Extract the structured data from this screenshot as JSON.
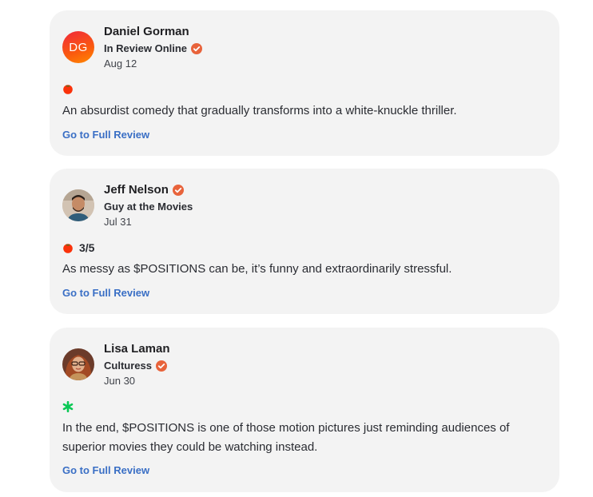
{
  "reviews": [
    {
      "initials": "DG",
      "critic": "Daniel Gorman",
      "publication": "In Review Online",
      "date": "Aug 12",
      "score": "",
      "quote": "An absurdist comedy that gradually transforms into a white-knuckle thriller.",
      "link": "Go to Full Review",
      "score_icon": "fresh-tomato-icon"
    },
    {
      "critic": "Jeff Nelson",
      "publication": "Guy at the Movies",
      "date": "Jul 31",
      "score": "3/5",
      "quote": "As messy as $POSITIONS can be, it’s funny and extraordinarily stressful.",
      "link": "Go to Full Review",
      "score_icon": "fresh-tomato-icon"
    },
    {
      "critic": "Lisa Laman",
      "publication": "Culturess",
      "date": "Jun 30",
      "score": "",
      "quote": "In the end, $POSITIONS is one of those motion pictures just reminding audiences of superior movies they could be watching instead.",
      "link": "Go to Full Review",
      "score_icon": "rotten-splat-icon"
    }
  ],
  "colors": {
    "card_bg": "#f3f3f3",
    "link": "#3a6fc5",
    "verified": "#e8633b",
    "fresh": "#fa320a",
    "rotten": "#0ac855"
  }
}
